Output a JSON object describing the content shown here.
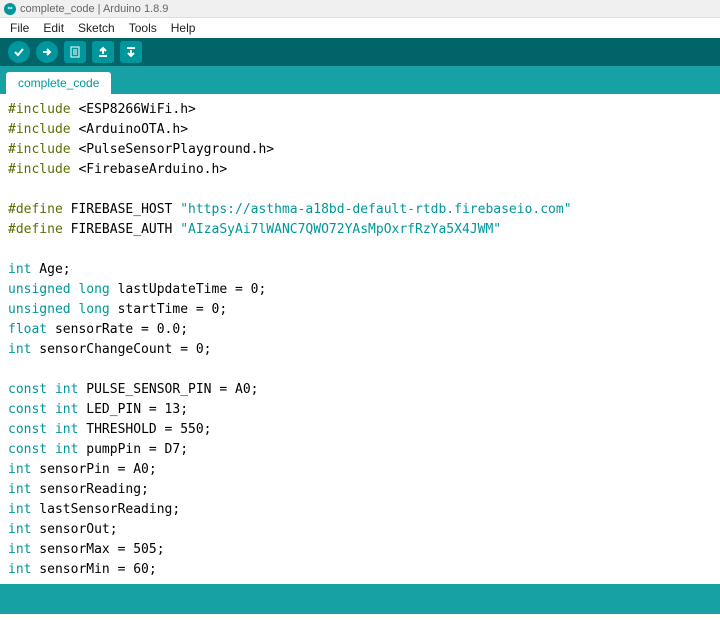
{
  "window": {
    "title": "complete_code | Arduino 1.8.9"
  },
  "menu": {
    "file": "File",
    "edit": "Edit",
    "sketch": "Sketch",
    "tools": "Tools",
    "help": "Help"
  },
  "tab": {
    "label": "complete_code"
  },
  "code": {
    "l1_kw": "#include",
    "l1_rest": " <ESP8266WiFi.h>",
    "l2_kw": "#include",
    "l2_rest": " <ArduinoOTA.h>",
    "l3_kw": "#include",
    "l3_rest": " <PulseSensorPlayground.h>",
    "l4_kw": "#include",
    "l4_rest": " <FirebaseArduino.h>",
    "l6_kw": "#define",
    "l6_mid": " FIREBASE_HOST ",
    "l6_str": "\"https://asthma-a18bd-default-rtdb.firebaseio.com\"",
    "l7_kw": "#define",
    "l7_mid": " FIREBASE_AUTH ",
    "l7_str": "\"AIzaSyAi7lWANC7QWO72YAsMpOxrfRzYa5X4JWM\"",
    "l9_t": "int",
    "l9_rest": " Age;",
    "l10_t": "unsigned long",
    "l10_rest": " lastUpdateTime = 0;",
    "l11_t": "unsigned long",
    "l11_rest": " startTime = 0;",
    "l12_t": "float",
    "l12_rest": " sensorRate = 0.0;",
    "l13_t": "int",
    "l13_rest": " sensorChangeCount = 0;",
    "l15_t": "const int",
    "l15_rest": " PULSE_SENSOR_PIN = A0;",
    "l16_t": "const int",
    "l16_rest": " LED_PIN = 13;",
    "l17_t": "const int",
    "l17_rest": " THRESHOLD = 550;",
    "l18_t": "const int",
    "l18_rest": " pumpPin = D7;",
    "l19_t": "int",
    "l19_rest": " sensorPin = A0;",
    "l20_t": "int",
    "l20_rest": " sensorReading;",
    "l21_t": "int",
    "l21_rest": " lastSensorReading;",
    "l22_t": "int",
    "l22_rest": " sensorOut;",
    "l23_t": "int",
    "l23_rest": " sensorMax = 505;",
    "l24_t": "int",
    "l24_rest": " sensorMin = 60;"
  }
}
